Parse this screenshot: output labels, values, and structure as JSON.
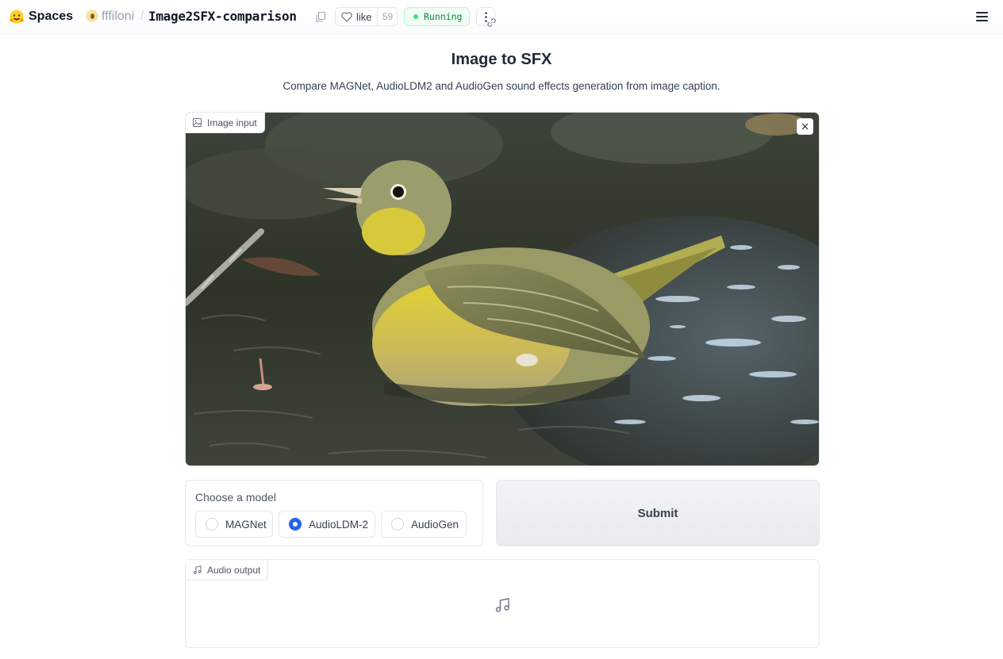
{
  "topbar": {
    "spaces_label": "Spaces",
    "owner": "fffiloni",
    "separator": "/",
    "repo_name": "Image2SFX-comparison",
    "like_label": "like",
    "like_count": "59",
    "status": "Running",
    "icons": [
      "hugging-face-logo",
      "copy-icon",
      "heart-icon",
      "more-options-icon",
      "link-icon",
      "menu-icon"
    ]
  },
  "app": {
    "title": "Image to SFX",
    "subtitle": "Compare MAGNet, AudioLDM2 and AudioGen sound effects generation from image caption."
  },
  "image_input": {
    "label": "Image input",
    "icons": [
      "image-icon",
      "close-icon"
    ]
  },
  "model_choice": {
    "label": "Choose a model",
    "options": [
      "MAGNet",
      "AudioLDM-2",
      "AudioGen"
    ],
    "selected": "AudioLDM-2"
  },
  "submit": {
    "label": "Submit"
  },
  "audio_output": {
    "label": "Audio output",
    "icons": [
      "music-note-icon"
    ]
  },
  "colors": {
    "accent": "#2563eb",
    "status_green": "#15803d",
    "border": "#e5e7eb"
  }
}
